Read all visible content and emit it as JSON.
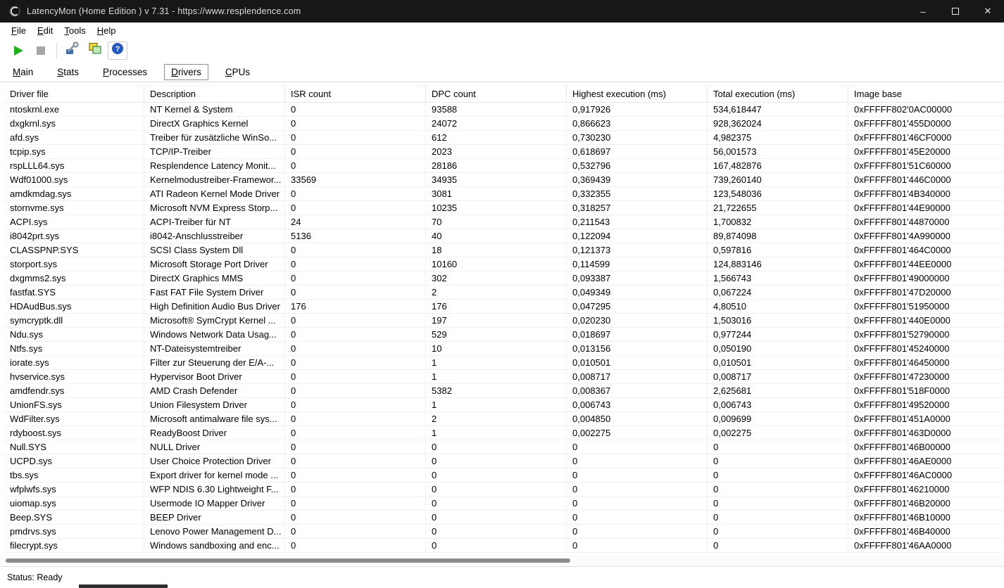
{
  "window": {
    "title": "LatencyMon  (Home Edition )  v 7.31 - https://www.resplendence.com",
    "minimize": "–",
    "close": "✕"
  },
  "menubar": [
    "File",
    "Edit",
    "Tools",
    "Help"
  ],
  "tabs": {
    "items": [
      "Main",
      "Stats",
      "Processes",
      "Drivers",
      "CPUs"
    ],
    "active": "Drivers"
  },
  "toolbar": {
    "icons": [
      "play-icon",
      "stop-icon",
      "driver-tools-icon",
      "copy-report-icon",
      "help-icon"
    ]
  },
  "colors": {
    "titlebar_bg": "#171717",
    "play_green": "#1db31d",
    "stop_gray": "#a6a6a6",
    "help_blue": "#2257c4",
    "icon_yellow": "#f3d642",
    "icon_green_fill": "#bfe8b8",
    "icon_green_stroke": "#1d7a1d"
  },
  "table": {
    "columns": [
      "Driver file",
      "Description",
      "ISR count",
      "DPC count",
      "Highest execution (ms)",
      "Total execution (ms)",
      "Image base"
    ],
    "rows": [
      [
        "ntoskrnl.exe",
        "NT Kernel & System",
        "0",
        "93588",
        "0,917926",
        "534,618447",
        "0xFFFFF802'0AC00000"
      ],
      [
        "dxgkrnl.sys",
        "DirectX Graphics Kernel",
        "0",
        "24072",
        "0,866623",
        "928,362024",
        "0xFFFFF801'455D0000"
      ],
      [
        "afd.sys",
        "Treiber für zusätzliche WinSo...",
        "0",
        "612",
        "0,730230",
        "4,982375",
        "0xFFFFF801'46CF0000"
      ],
      [
        "tcpip.sys",
        "TCP/IP-Treiber",
        "0",
        "2023",
        "0,618697",
        "56,001573",
        "0xFFFFF801'45E20000"
      ],
      [
        "rspLLL64.sys",
        "Resplendence Latency Monit...",
        "0",
        "28186",
        "0,532796",
        "167,482876",
        "0xFFFFF801'51C60000"
      ],
      [
        "Wdf01000.sys",
        "Kernelmodustreiber-Framewor...",
        "33569",
        "34935",
        "0,369439",
        "739,260140",
        "0xFFFFF801'446C0000"
      ],
      [
        "amdkmdag.sys",
        "ATI Radeon Kernel Mode Driver",
        "0",
        "3081",
        "0,332355",
        "123,548036",
        "0xFFFFF801'4B340000"
      ],
      [
        "stornvme.sys",
        "Microsoft NVM Express Storp...",
        "0",
        "10235",
        "0,318257",
        "21,722655",
        "0xFFFFF801'44E90000"
      ],
      [
        "ACPI.sys",
        "ACPI-Treiber für NT",
        "24",
        "70",
        "0,211543",
        "1,700832",
        "0xFFFFF801'44870000"
      ],
      [
        "i8042prt.sys",
        "i8042-Anschlusstreiber",
        "5136",
        "40",
        "0,122094",
        "89,874098",
        "0xFFFFF801'4A990000"
      ],
      [
        "CLASSPNP.SYS",
        "SCSI Class System Dll",
        "0",
        "18",
        "0,121373",
        "0,597816",
        "0xFFFFF801'464C0000"
      ],
      [
        "storport.sys",
        "Microsoft Storage Port Driver",
        "0",
        "10160",
        "0,114599",
        "124,883146",
        "0xFFFFF801'44EE0000"
      ],
      [
        "dxgmms2.sys",
        "DirectX Graphics MMS",
        "0",
        "302",
        "0,093387",
        "1,566743",
        "0xFFFFF801'49000000"
      ],
      [
        "fastfat.SYS",
        "Fast FAT File System Driver",
        "0",
        "2",
        "0,049349",
        "0,067224",
        "0xFFFFF801'47D20000"
      ],
      [
        "HDAudBus.sys",
        "High Definition Audio Bus Driver",
        "176",
        "176",
        "0,047295",
        "4,80510",
        "0xFFFFF801'51950000"
      ],
      [
        "symcryptk.dll",
        "Microsoft® SymCrypt Kernel ...",
        "0",
        "197",
        "0,020230",
        "1,503016",
        "0xFFFFF801'440E0000"
      ],
      [
        "Ndu.sys",
        "Windows Network Data Usag...",
        "0",
        "529",
        "0,018697",
        "0,977244",
        "0xFFFFF801'52790000"
      ],
      [
        "Ntfs.sys",
        "NT-Dateisystemtreiber",
        "0",
        "10",
        "0,013156",
        "0,050190",
        "0xFFFFF801'45240000"
      ],
      [
        "iorate.sys",
        "Filter zur Steuerung der E/A-...",
        "0",
        "1",
        "0,010501",
        "0,010501",
        "0xFFFFF801'46450000"
      ],
      [
        "hvservice.sys",
        "Hypervisor Boot Driver",
        "0",
        "1",
        "0,008717",
        "0,008717",
        "0xFFFFF801'47230000"
      ],
      [
        "amdfendr.sys",
        "AMD Crash Defender",
        "0",
        "5382",
        "0,008367",
        "2,625681",
        "0xFFFFF801'518F0000"
      ],
      [
        "UnionFS.sys",
        "Union Filesystem Driver",
        "0",
        "1",
        "0,006743",
        "0,006743",
        "0xFFFFF801'49520000"
      ],
      [
        "WdFilter.sys",
        "Microsoft antimalware file sys...",
        "0",
        "2",
        "0,004850",
        "0,009699",
        "0xFFFFF801'451A0000"
      ],
      [
        "rdyboost.sys",
        "ReadyBoost Driver",
        "0",
        "1",
        "0,002275",
        "0,002275",
        "0xFFFFF801'463D0000"
      ],
      [
        "Null.SYS",
        "NULL Driver",
        "0",
        "0",
        "0",
        "0",
        "0xFFFFF801'46B00000"
      ],
      [
        "UCPD.sys",
        "User Choice Protection Driver",
        "0",
        "0",
        "0",
        "0",
        "0xFFFFF801'46AE0000"
      ],
      [
        "tbs.sys",
        "Export driver for kernel mode ...",
        "0",
        "0",
        "0",
        "0",
        "0xFFFFF801'46AC0000"
      ],
      [
        "wfplwfs.sys",
        "WFP NDIS 6.30 Lightweight F...",
        "0",
        "0",
        "0",
        "0",
        "0xFFFFF801'46210000"
      ],
      [
        "uiomap.sys",
        "Usermode IO Mapper Driver",
        "0",
        "0",
        "0",
        "0",
        "0xFFFFF801'46B20000"
      ],
      [
        "Beep.SYS",
        "BEEP Driver",
        "0",
        "0",
        "0",
        "0",
        "0xFFFFF801'46B10000"
      ],
      [
        "pmdrvs.sys",
        "Lenovo Power Management D...",
        "0",
        "0",
        "0",
        "0",
        "0xFFFFF801'46B40000"
      ],
      [
        "filecrypt.sys",
        "Windows sandboxing and enc...",
        "0",
        "0",
        "0",
        "0",
        "0xFFFFF801'46AA0000"
      ]
    ]
  },
  "statusbar": {
    "text": "Status: Ready"
  }
}
